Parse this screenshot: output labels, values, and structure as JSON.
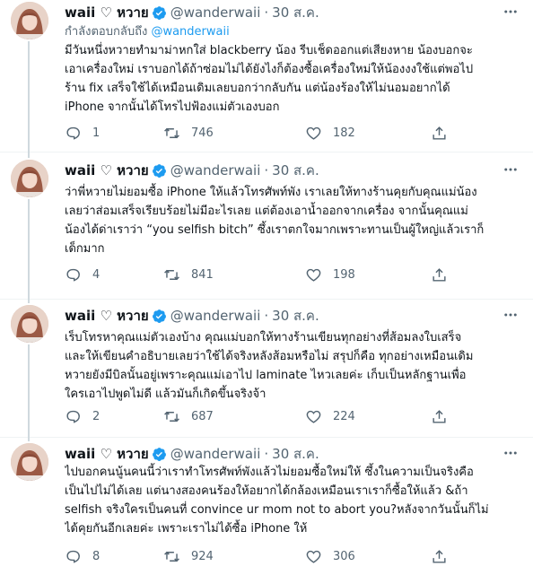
{
  "colors": {
    "accent": "#1d9bf0",
    "secondary_text": "#536471",
    "primary_text": "#0f1419",
    "thread_line": "#cfd9de"
  },
  "icons": {
    "verified": "verified-badge-icon",
    "more": "more-horizontal-icon",
    "reply": "reply-icon",
    "retweet": "retweet-icon",
    "like": "heart-icon",
    "share": "share-icon"
  },
  "tweets": [
    {
      "display_name": "waii ♡ หวาย",
      "handle": "@wanderwaii",
      "separator": "·",
      "date": "30 ส.ค.",
      "replying_prefix": "กำลังตอบกลับถึง",
      "replying_to": "@wanderwaii",
      "lines": [
        "มีวันหนึ่งหวายทำมาม่าหกใส่ blackberry น้อง รีบเช็ดออกแต่เสียงหาย น้องบอกจะ",
        "เอาเครื่องใหม่ เราบอกได้ถ้าซ่อมไม่ได้ยังไงก็ต้องซื้อเครื่องใหม่ให้น้องงงใช้แต่พอไป",
        "ร้าน fix เสร็จใช้ได้เหมือนเดิมเลยบอกว่ากลับกัน แต่น้องร้องให้ไม่นอมอยากได้",
        "iPhone จากนั้นได้โทรไปฟ้องแม่ตัวเองบอก"
      ],
      "replies": "1",
      "retweets": "746",
      "likes": "182"
    },
    {
      "display_name": "waii ♡ หวาย",
      "handle": "@wanderwaii",
      "separator": "·",
      "date": "30 ส.ค.",
      "lines": [
        "ว่าพี่หวายไม่ยอมซื้อ iPhone ให้แล้วโทรศัพท์พัง เราเลยให้ทางร้านคุยกับคุณแม่น้อง",
        "เลยว่าส่อมเสร็จเรียบร้อยไม่มีอะไรเลย แต่ต้องเอาน้ำออกจากเครื่อง จากนั้นคุณแม่",
        "น้องได้ด่าเราว่า “you selfish bitch” ซึ้งเราตกใจมากเพราะทานเป็นผู้ใหญ่แล้วเราก็",
        "เด็กมาก"
      ],
      "replies": "4",
      "retweets": "841",
      "likes": "198"
    },
    {
      "display_name": "waii ♡ หวาย",
      "handle": "@wanderwaii",
      "separator": "·",
      "date": "30 ส.ค.",
      "lines": [
        "เร็บโทรหาคุณแม่ตัวเองบ้าง คุณแม่บอกให้ทางร้านเขียนทุกอย่างที่ส้อมลงใบเสร็จ",
        "และให้เขียนคำอธิบายเลยว่าใช้ได้จริงหลังส้อมหรือไม่ สรุปก็คือ ทุกอย่างเหมือนเดิม",
        "หวายยังมีบิลนั้นอยู่เพราะคุณแม่เอาไป laminate ไหวเลยค่ะ เก็บเป็นหลักฐานเพื่อ",
        "ใครเอาไปพูดไม่ดี แล้วมันก็เกิดขึ้นจริงจ้า"
      ],
      "replies": "2",
      "retweets": "687",
      "likes": "224"
    },
    {
      "display_name": "waii ♡ หวาย",
      "handle": "@wanderwaii",
      "separator": "·",
      "date": "30 ส.ค.",
      "lines": [
        "ไปบอกคนนู้นคนนี้ว่าเราทำโทรศัพท์พังแล้วไม่ยอมซื้อใหม่ให้ ซึ้งในความเป็นจริงคือ",
        "เป็นไปไม่ได้เลย แต่นางสองคนร้องให้อยากได้กล้องเหมือนเราเราก็ซื้อให้แล้ว &ถ้า",
        "selfish จริงใครเป็นคนที่ convince ur mom not to abort you?หลังจากวันนั้นก็ไม่",
        "ได้คุยกันอีกเลยค่ะ เพราะเราไม่ได้ซื้อ iPhone ให้"
      ],
      "replies": "8",
      "retweets": "924",
      "likes": "306"
    }
  ]
}
